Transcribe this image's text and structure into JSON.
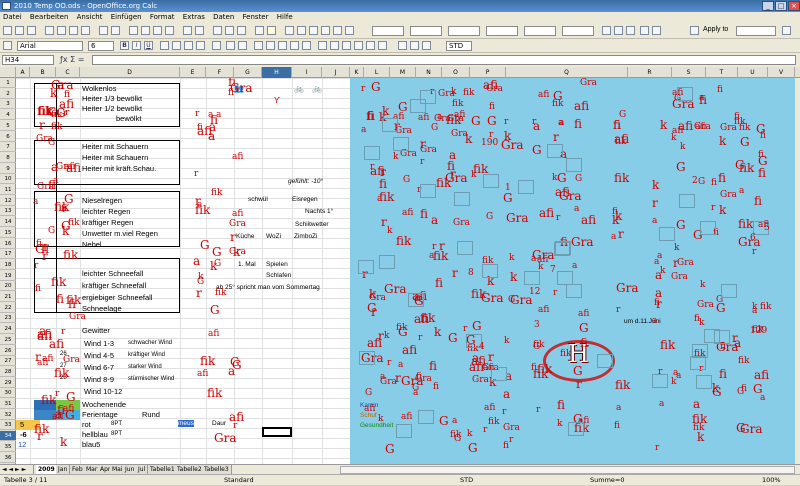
{
  "window": {
    "title": "2010 Temp OO.ods - OpenOffice.org Calc"
  },
  "menu": [
    "Datei",
    "Bearbeiten",
    "Ansicht",
    "Einfügen",
    "Format",
    "Extras",
    "Daten",
    "Fenster",
    "Hilfe"
  ],
  "toolbar": {
    "font_name": "Arial",
    "font_size": "6",
    "apply_style": "Apply to",
    "zoom_field": "STD"
  },
  "formula": {
    "cell_ref": "H34",
    "input": ""
  },
  "columns": [
    "A",
    "B",
    "C",
    "D",
    "E",
    "F",
    "G",
    "H",
    "I",
    "J",
    "K",
    "L",
    "M",
    "N",
    "O",
    "P",
    "Q",
    "R",
    "S",
    "T",
    "U",
    "V"
  ],
  "rows": [
    "1",
    "2",
    "3",
    "4",
    "5",
    "6",
    "7",
    "8",
    "9",
    "10",
    "11",
    "12",
    "13",
    "14",
    "15",
    "16",
    "17",
    "18",
    "19",
    "20",
    "21",
    "22",
    "23",
    "24",
    "25",
    "26",
    "27",
    "28",
    "29",
    "30",
    "31",
    "32",
    "33",
    "34",
    "35",
    "36"
  ],
  "weather": {
    "r2": "Wolkenlos",
    "r3": "Heiter  1/3 bewölkt",
    "r4": "Heiter  1/2 bewölkt",
    "r5": "bewölkt",
    "r7": "Heiter mit Schauern",
    "r8": "Heiter mit Schauern",
    "r9": "Heiter mit kräft.Schau.",
    "r12": "Nieselregen",
    "r13": "leichter Regen",
    "r14": "kräftiger Regen",
    "r15": "Unwetter m.viel Regen",
    "r16": "Nebel",
    "r19": "leichter Schneefall",
    "r20": "kräftiger Schneefall",
    "r21": "ergiebiger Schneefall",
    "r22": "Schneelage",
    "r24": "Gewitter",
    "r25": "Wind 1-3",
    "r26": "Wind 4-5",
    "r27": "Wind 6-7",
    "r28": "Wind 8-9",
    "r29": "Wind 10-12",
    "r31": "Wochenende",
    "r32": "Ferientage",
    "r33": "rot",
    "r34": "hellblau",
    "r35": "blau5"
  },
  "wind_notes": {
    "w25": "schwacher Wind",
    "w26": "kräftiger Wind",
    "w27": "starker Wind",
    "w28": "stürmischer Wind"
  },
  "side_numbers": {
    "n26": "26",
    "n27": "27",
    "n28": "28",
    "n33": "5",
    "n34": "-6",
    "n35": "12"
  },
  "misc": {
    "gefuehlt": "gefühlt: -10°",
    "schwuel": "schwül",
    "eisregen": "Eisregen",
    "nachts": "Nachts 1°",
    "schiitwetter": "Schiitwetter",
    "kueche": "Küche",
    "wozi": "WoZi",
    "zimbozi": "ZimboZi",
    "mal": "1. Mal",
    "spielen": "Spielen",
    "schlafen": "Schlafen",
    "spricht": "ab 25° spricht man vom Sommertag",
    "rund": "Rund",
    "spt1": "8PT",
    "spt2": "8PT",
    "undi": "um d.11.Juni",
    "kamin": "Kamin",
    "schuf": "Schuf",
    "Gesundheit": "Gesundheit",
    "nmeus": "meus",
    "daur": "Daur"
  },
  "labels_red": [
    "G",
    "r",
    "a",
    "fi",
    "k",
    "afi",
    "Gra",
    "fik"
  ],
  "numbers_red": [
    "12",
    "129",
    "190",
    "1",
    "2",
    "3",
    "4",
    "5",
    "6",
    "7",
    "8"
  ],
  "tabs": [
    "2009",
    "Jan",
    "Feb",
    "Mar",
    "Apr",
    "Mai",
    "Jun",
    "Jul",
    "Tabelle1",
    "Tabelle2",
    "Tabelle3"
  ],
  "status": {
    "sheet": "Tabelle 3 / 11",
    "style": "Standard",
    "mode": "STD",
    "sum": "Summe=0",
    "zoom": "100%"
  },
  "logo": {
    "letter": "H"
  }
}
